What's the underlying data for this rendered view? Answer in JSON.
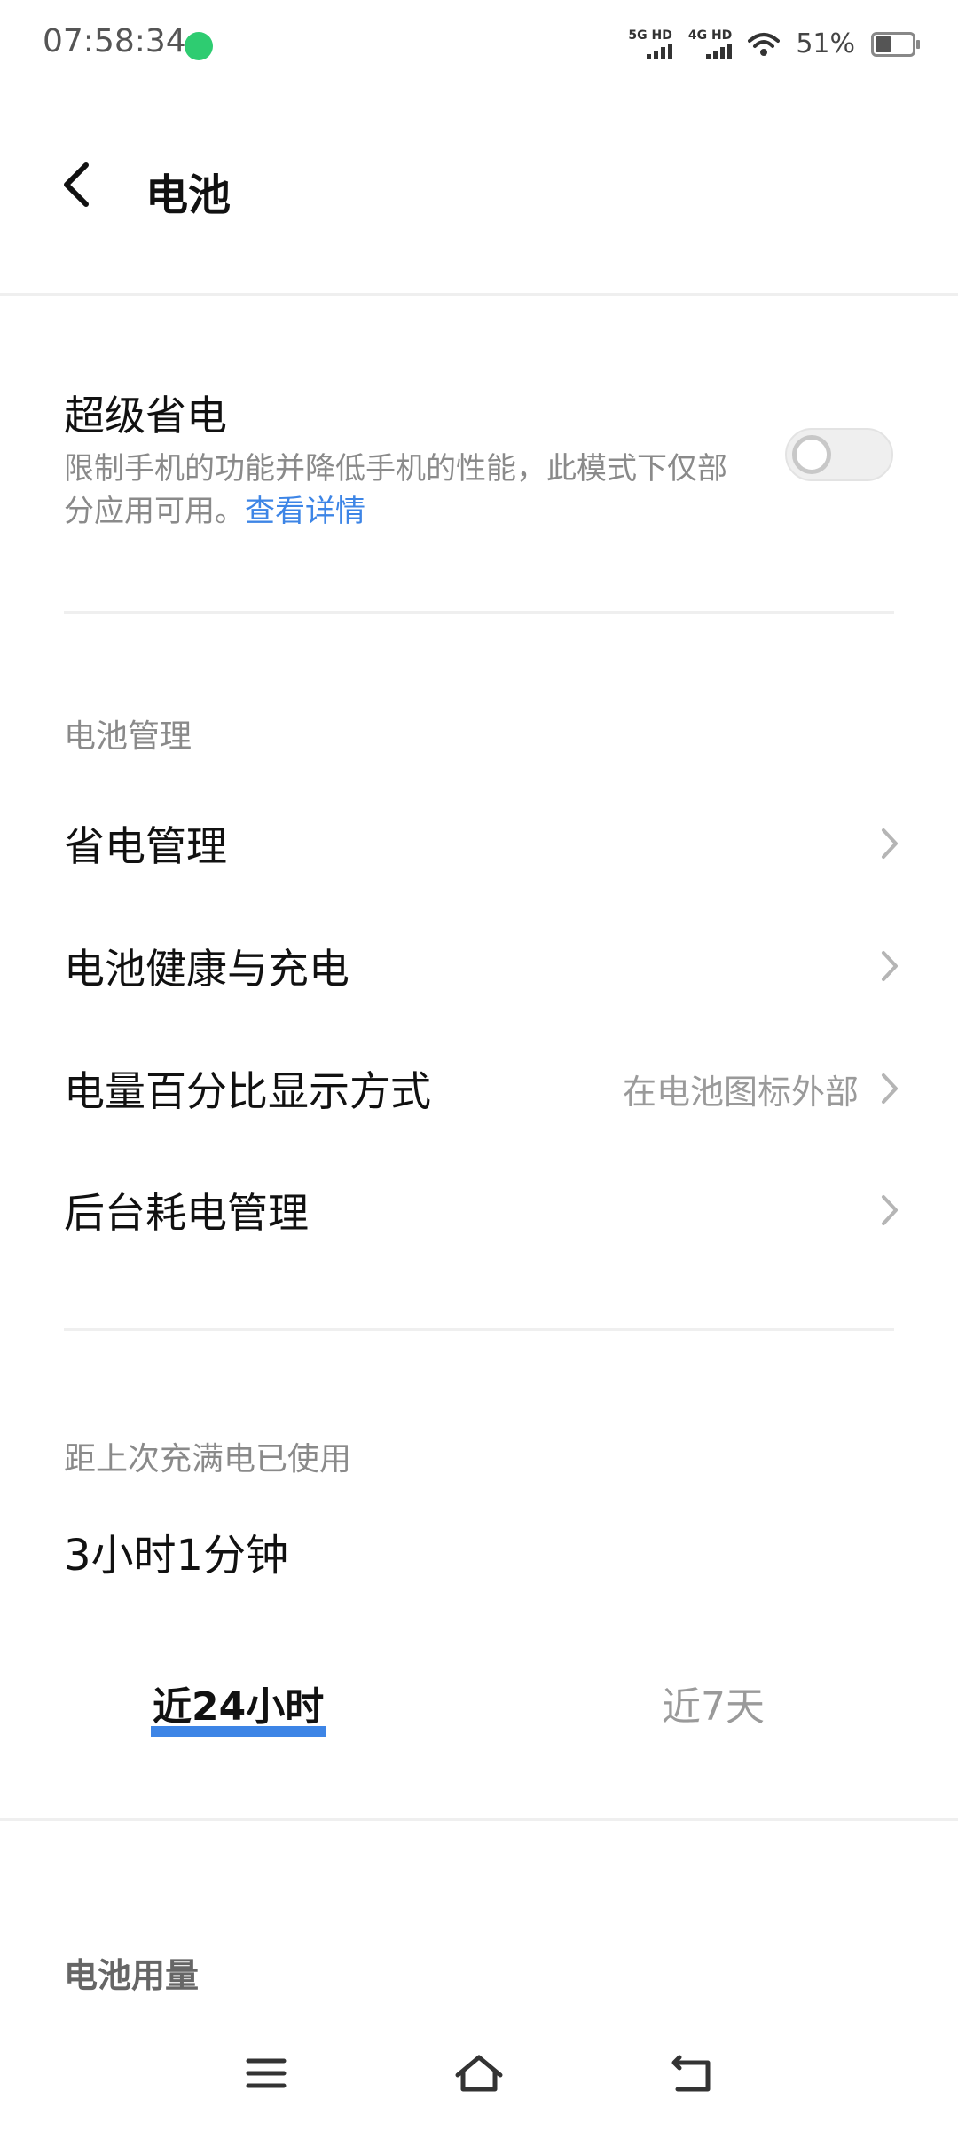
{
  "status_bar": {
    "time": "07:58:34",
    "sim1_label": "5G HD",
    "sim2_label": "4G HD",
    "battery_percent": "51%",
    "battery_level": 0.51
  },
  "header": {
    "title": "电池",
    "back_icon": "chevron-left-icon"
  },
  "super_saver": {
    "title": "超级省电",
    "description": "限制手机的功能并降低手机的性能，此模式下仅部分应用可用。",
    "link": "查看详情",
    "enabled": false
  },
  "battery_management": {
    "header": "电池管理",
    "items": [
      {
        "label": "省电管理",
        "value": ""
      },
      {
        "label": "电池健康与充电",
        "value": ""
      },
      {
        "label": "电量百分比显示方式",
        "value": "在电池图标外部"
      },
      {
        "label": "后台耗电管理",
        "value": ""
      }
    ]
  },
  "usage": {
    "header": "距上次充满电已使用",
    "value": "3小时1分钟",
    "tabs": [
      {
        "label": "近24小时",
        "active": true
      },
      {
        "label": "近7天",
        "active": false
      }
    ],
    "accent_color": "#3d85e6"
  },
  "battery_usage": {
    "title": "电池用量"
  },
  "nav_bar": {
    "icons": [
      "menu-icon",
      "home-icon",
      "back-icon"
    ]
  }
}
